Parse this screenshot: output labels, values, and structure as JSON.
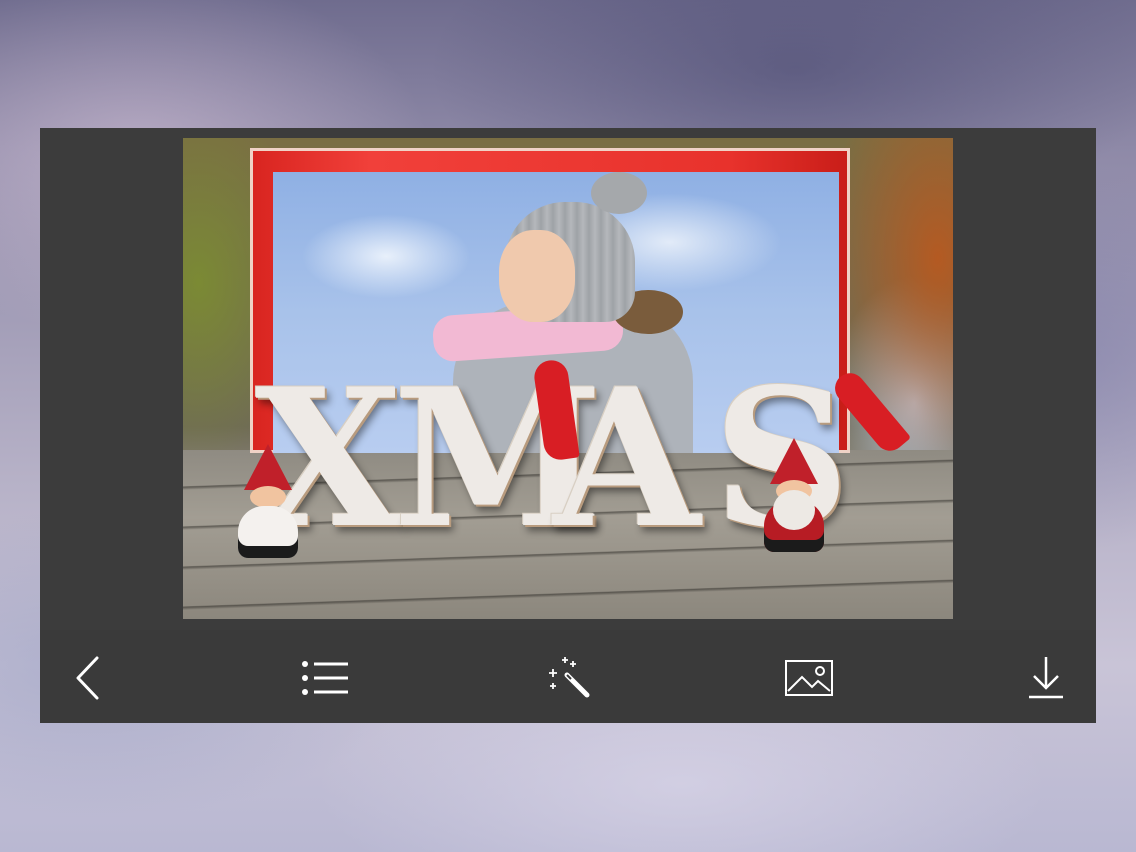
{
  "app": {
    "screen": "photo-frame-editor"
  },
  "photo": {
    "overlay_text": "XMAS",
    "letters": [
      "X",
      "M",
      "A",
      "S"
    ],
    "frame_color": "#e8302a"
  },
  "toolbar": {
    "buttons": [
      {
        "name": "back-button",
        "icon": "chevron-left-icon"
      },
      {
        "name": "frames-list-button",
        "icon": "list-icon"
      },
      {
        "name": "effects-button",
        "icon": "magic-wand-icon"
      },
      {
        "name": "gallery-button",
        "icon": "image-icon"
      },
      {
        "name": "download-button",
        "icon": "download-icon"
      }
    ],
    "icon_color": "#ffffff",
    "background": "#3a3a3a"
  }
}
